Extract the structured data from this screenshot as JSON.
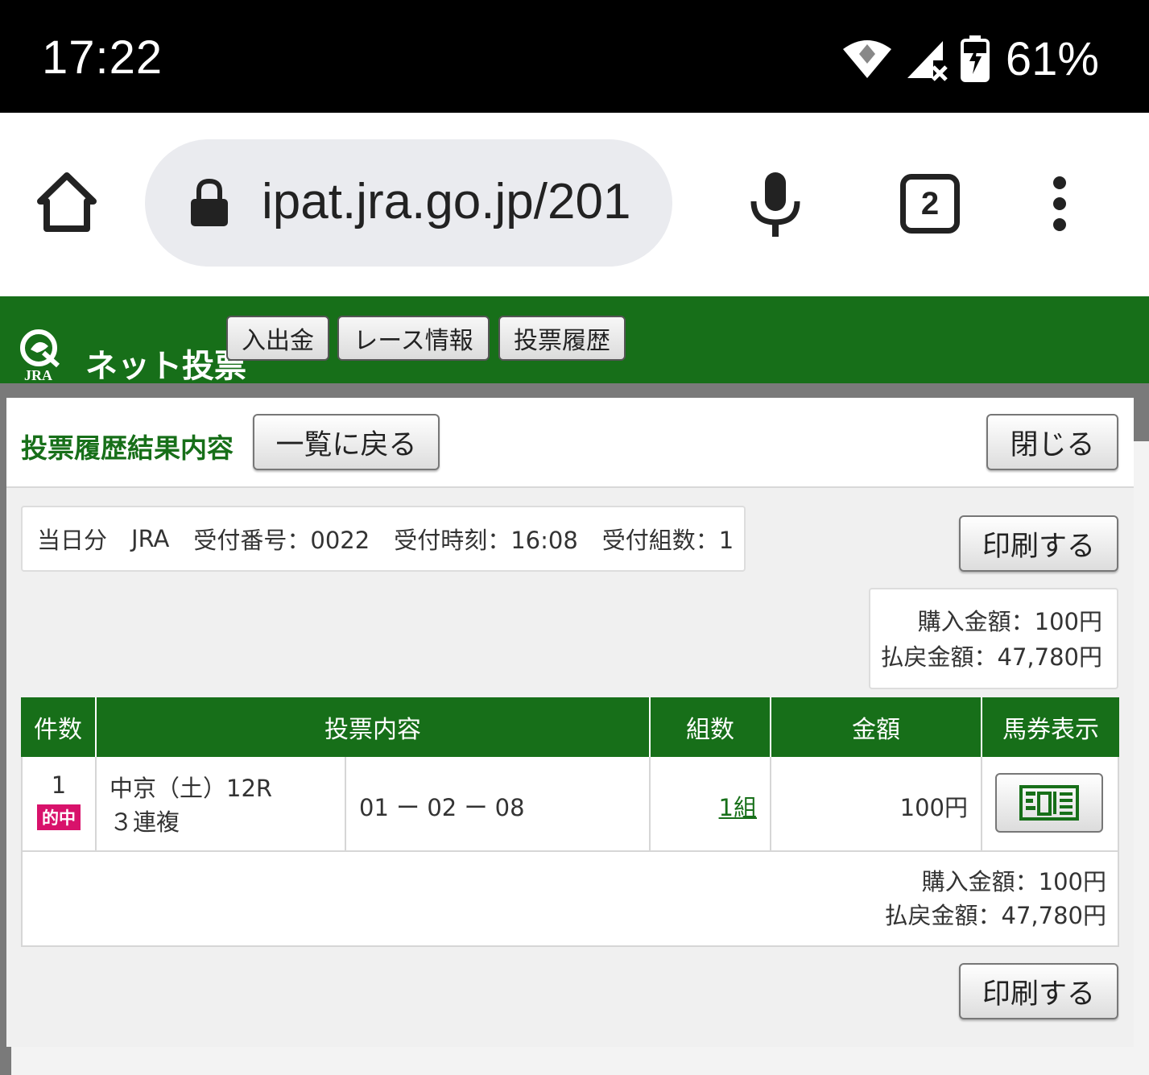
{
  "status_bar": {
    "time": "17:22",
    "battery": "61%",
    "icons": [
      "wifi-icon",
      "signal-off-icon",
      "battery-charging-icon"
    ]
  },
  "browser": {
    "url": "ipat.jra.go.jp/201",
    "tab_count": "2",
    "icons": [
      "home-icon",
      "lock-icon",
      "mic-icon",
      "tabs-icon",
      "more-vert-icon"
    ]
  },
  "site_header": {
    "logo_text": "ネット投票",
    "logo_sub": "JRA",
    "nav": [
      "入出金",
      "レース情報",
      "投票履歴"
    ],
    "colors": {
      "brand_green": "#176f19"
    }
  },
  "modal": {
    "title": "投票履歴結果内容",
    "back_button": "一覧に戻る",
    "close_button": "閉じる",
    "info": {
      "day": "当日分",
      "org": "JRA",
      "receipt_no": "受付番号：0022",
      "receipt_time": "受付時刻：16:08",
      "combo_count": "受付組数：1"
    },
    "print_button": "印刷する",
    "summary": {
      "purchase": "購入金額：100円",
      "payout": "払戻金額：47,780円"
    },
    "table": {
      "headers": [
        "件数",
        "投票内容",
        "組数",
        "金額",
        "馬券表示"
      ],
      "row": {
        "count": "1",
        "hit_badge": "的中",
        "race": "中京（土）12R",
        "bet_type": "３連複",
        "numbers": "01 ー 02 ー 08",
        "combos": "1組",
        "amount": "100円"
      },
      "footer": {
        "purchase": "購入金額：100円",
        "payout": "払戻金額：47,780円"
      }
    },
    "print_button_bottom": "印刷する",
    "colors": {
      "hit_badge": "#d8126b"
    }
  }
}
